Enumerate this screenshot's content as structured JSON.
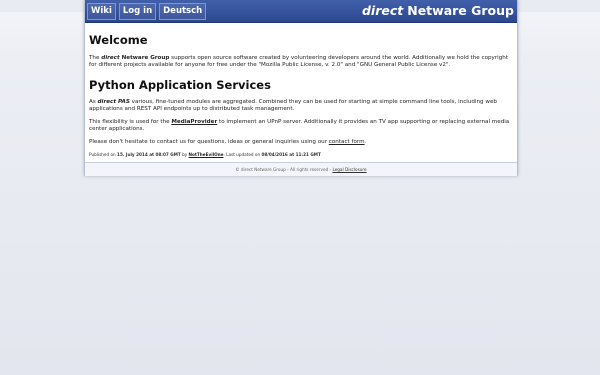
{
  "header": {
    "nav": [
      "Wiki",
      "Log in",
      "Deutsch"
    ],
    "brand_em": "direct",
    "brand_rest": "Netware Group"
  },
  "welcome": {
    "title": "Welcome",
    "p1_pre": "The ",
    "p1_em": "direct",
    "p1_b": " Netware Group",
    "p1_rest": " supports open source software created by volunteering developers around the world. Additionally we hold the copyright for different projects available for anyone for free under the \"Mozilla Public License, v. 2.0\" and \"GNU General Public License v2\"."
  },
  "pas": {
    "title": "Python Application Services",
    "p1_pre": "As ",
    "p1_em": "direct PAS",
    "p1_rest": " various, fine-tuned modules are aggregated. Combined they can be used for starting at simple command line tools, including web applications and REST API endpoints up to distributed task management.",
    "p2_pre": "This flexibility is used for the ",
    "p2_link": "MediaProvider",
    "p2_rest": " to implement an UPnP server. Additionally it provides an TV app supporting or replacing external media center applications.",
    "p3_pre": "Please don't hesitate to contact us for questions, ideas or general inquiries using our ",
    "p3_link": "contact form",
    "p3_post": "."
  },
  "published": {
    "label": "Published on ",
    "date": "15. July 2014 at 08:07 GMT",
    "by": " by ",
    "author": "NotTheEvilOne",
    "updated_label": ". Last updated on ",
    "updated": "08/04/2016 at 11:21 GMT"
  },
  "footer": {
    "text": "© direct Netware Group - All rights reserved - ",
    "link": "Legal Disclosure"
  }
}
